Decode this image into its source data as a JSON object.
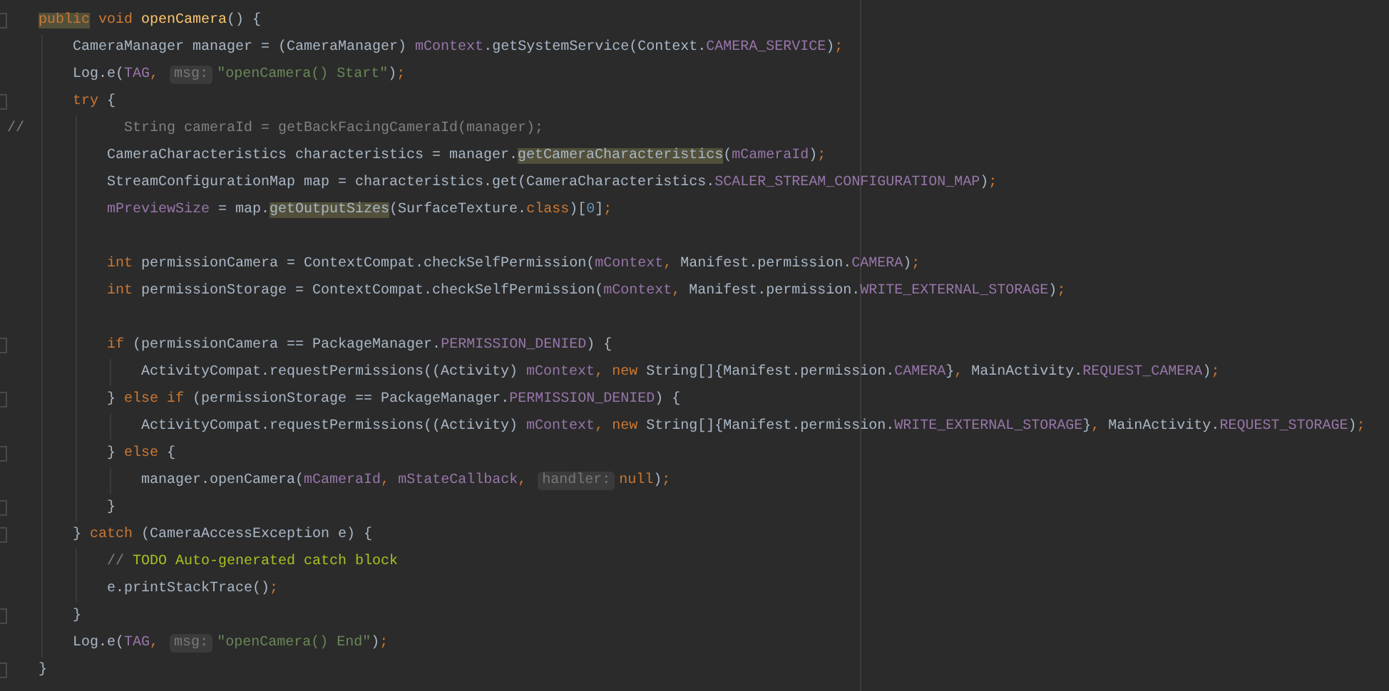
{
  "editor": {
    "lines": [
      {
        "kind": "code",
        "fold_marker": true,
        "tokens": [
          {
            "kind": "keyword_highlight",
            "text": "public"
          },
          {
            "kind": "keyword",
            "text": " void"
          },
          {
            "kind": "method",
            "text": " openCamera"
          },
          {
            "kind": "plain",
            "text": "() {"
          }
        ],
        "children": [
          {
            "kind": "code",
            "fold_marker": false,
            "tokens": [
              {
                "kind": "plain",
                "text": "CameraManager manager = (CameraManager) "
              },
              {
                "kind": "field",
                "text": "mContext"
              },
              {
                "kind": "plain",
                "text": ".getSystemService(Context."
              },
              {
                "kind": "field",
                "text": "CAMERA_SERVICE"
              },
              {
                "kind": "plain",
                "text": ")"
              },
              {
                "kind": "keyword",
                "text": ";"
              }
            ]
          },
          {
            "kind": "code",
            "fold_marker": false,
            "tokens": [
              {
                "kind": "plain",
                "text": "Log.e("
              },
              {
                "kind": "field",
                "text": "TAG"
              },
              {
                "kind": "keyword",
                "text": ", "
              },
              {
                "kind": "hint",
                "text": "msg:"
              },
              {
                "kind": "string",
                "text": "\"openCamera() Start\""
              },
              {
                "kind": "plain",
                "text": ")"
              },
              {
                "kind": "keyword",
                "text": ";"
              }
            ]
          },
          {
            "kind": "code",
            "fold_marker": true,
            "tokens": [
              {
                "kind": "keyword",
                "text": "try"
              },
              {
                "kind": "plain",
                "text": " {"
              }
            ],
            "children": [
              {
                "kind": "commented",
                "fold_marker": false,
                "prefix": "//",
                "tokens": [
                  {
                    "kind": "comment",
                    "text": "String cameraId = getBackFacingCameraId(manager);"
                  }
                ]
              },
              {
                "kind": "code",
                "fold_marker": false,
                "tokens": [
                  {
                    "kind": "plain",
                    "text": "CameraCharacteristics characteristics = manager."
                  },
                  {
                    "kind": "highlight",
                    "text": "getCameraCharacteristics"
                  },
                  {
                    "kind": "plain",
                    "text": "("
                  },
                  {
                    "kind": "field",
                    "text": "mCameraId"
                  },
                  {
                    "kind": "plain",
                    "text": ")"
                  },
                  {
                    "kind": "keyword",
                    "text": ";"
                  }
                ]
              },
              {
                "kind": "code",
                "fold_marker": false,
                "tokens": [
                  {
                    "kind": "plain",
                    "text": "StreamConfigurationMap map = characteristics.get(CameraCharacteristics."
                  },
                  {
                    "kind": "field",
                    "text": "SCALER_STREAM_CONFIGURATION_MAP"
                  },
                  {
                    "kind": "plain",
                    "text": ")"
                  },
                  {
                    "kind": "keyword",
                    "text": ";"
                  }
                ]
              },
              {
                "kind": "code",
                "fold_marker": false,
                "tokens": [
                  {
                    "kind": "field",
                    "text": "mPreviewSize"
                  },
                  {
                    "kind": "plain",
                    "text": " = map."
                  },
                  {
                    "kind": "highlight",
                    "text": "getOutputSizes"
                  },
                  {
                    "kind": "plain",
                    "text": "(SurfaceTexture."
                  },
                  {
                    "kind": "keyword",
                    "text": "class"
                  },
                  {
                    "kind": "plain",
                    "text": ")["
                  },
                  {
                    "kind": "number",
                    "text": "0"
                  },
                  {
                    "kind": "plain",
                    "text": "]"
                  },
                  {
                    "kind": "keyword",
                    "text": ";"
                  }
                ]
              },
              {
                "kind": "blank",
                "fold_marker": false
              },
              {
                "kind": "code",
                "fold_marker": false,
                "tokens": [
                  {
                    "kind": "keyword",
                    "text": "int"
                  },
                  {
                    "kind": "plain",
                    "text": " permissionCamera = ContextCompat.checkSelfPermission("
                  },
                  {
                    "kind": "field",
                    "text": "mContext"
                  },
                  {
                    "kind": "keyword",
                    "text": ","
                  },
                  {
                    "kind": "plain",
                    "text": " Manifest.permission."
                  },
                  {
                    "kind": "field",
                    "text": "CAMERA"
                  },
                  {
                    "kind": "plain",
                    "text": ")"
                  },
                  {
                    "kind": "keyword",
                    "text": ";"
                  }
                ]
              },
              {
                "kind": "code",
                "fold_marker": false,
                "tokens": [
                  {
                    "kind": "keyword",
                    "text": "int"
                  },
                  {
                    "kind": "plain",
                    "text": " permissionStorage = ContextCompat.checkSelfPermission("
                  },
                  {
                    "kind": "field",
                    "text": "mContext"
                  },
                  {
                    "kind": "keyword",
                    "text": ","
                  },
                  {
                    "kind": "plain",
                    "text": " Manifest.permission."
                  },
                  {
                    "kind": "field",
                    "text": "WRITE_EXTERNAL_STORAGE"
                  },
                  {
                    "kind": "plain",
                    "text": ")"
                  },
                  {
                    "kind": "keyword",
                    "text": ";"
                  }
                ]
              },
              {
                "kind": "blank",
                "fold_marker": false
              },
              {
                "kind": "code",
                "fold_marker": true,
                "tokens": [
                  {
                    "kind": "keyword",
                    "text": "if"
                  },
                  {
                    "kind": "plain",
                    "text": " (permissionCamera == PackageManager."
                  },
                  {
                    "kind": "field",
                    "text": "PERMISSION_DENIED"
                  },
                  {
                    "kind": "plain",
                    "text": ") {"
                  }
                ],
                "children": [
                  {
                    "kind": "code",
                    "fold_marker": false,
                    "tokens": [
                      {
                        "kind": "plain",
                        "text": "ActivityCompat.requestPermissions((Activity) "
                      },
                      {
                        "kind": "field",
                        "text": "mContext"
                      },
                      {
                        "kind": "keyword",
                        "text": ", new"
                      },
                      {
                        "kind": "plain",
                        "text": " String[]{Manifest.permission."
                      },
                      {
                        "kind": "field",
                        "text": "CAMERA"
                      },
                      {
                        "kind": "plain",
                        "text": "}"
                      },
                      {
                        "kind": "keyword",
                        "text": ","
                      },
                      {
                        "kind": "plain",
                        "text": " MainActivity."
                      },
                      {
                        "kind": "field",
                        "text": "REQUEST_CAMERA"
                      },
                      {
                        "kind": "plain",
                        "text": ")"
                      },
                      {
                        "kind": "keyword",
                        "text": ";"
                      }
                    ]
                  }
                ]
              },
              {
                "kind": "code",
                "fold_marker": true,
                "tokens": [
                  {
                    "kind": "plain",
                    "text": "} "
                  },
                  {
                    "kind": "keyword",
                    "text": "else if"
                  },
                  {
                    "kind": "plain",
                    "text": " (permissionStorage == PackageManager."
                  },
                  {
                    "kind": "field",
                    "text": "PERMISSION_DENIED"
                  },
                  {
                    "kind": "plain",
                    "text": ") {"
                  }
                ],
                "children": [
                  {
                    "kind": "code",
                    "fold_marker": false,
                    "tokens": [
                      {
                        "kind": "plain",
                        "text": "ActivityCompat.requestPermissions((Activity) "
                      },
                      {
                        "kind": "field",
                        "text": "mContext"
                      },
                      {
                        "kind": "keyword",
                        "text": ", new"
                      },
                      {
                        "kind": "plain",
                        "text": " String[]{Manifest.permission."
                      },
                      {
                        "kind": "field",
                        "text": "WRITE_EXTERNAL_STORAGE"
                      },
                      {
                        "kind": "plain",
                        "text": "}"
                      },
                      {
                        "kind": "keyword",
                        "text": ","
                      },
                      {
                        "kind": "plain",
                        "text": " MainActivity."
                      },
                      {
                        "kind": "field",
                        "text": "REQUEST_STORAGE"
                      },
                      {
                        "kind": "plain",
                        "text": ")"
                      },
                      {
                        "kind": "keyword",
                        "text": ";"
                      }
                    ]
                  }
                ]
              },
              {
                "kind": "code",
                "fold_marker": true,
                "tokens": [
                  {
                    "kind": "plain",
                    "text": "} "
                  },
                  {
                    "kind": "keyword",
                    "text": "else"
                  },
                  {
                    "kind": "plain",
                    "text": " {"
                  }
                ],
                "children": [
                  {
                    "kind": "code",
                    "fold_marker": false,
                    "tokens": [
                      {
                        "kind": "plain",
                        "text": "manager.openCamera("
                      },
                      {
                        "kind": "field",
                        "text": "mCameraId"
                      },
                      {
                        "kind": "keyword",
                        "text": ","
                      },
                      {
                        "kind": "field",
                        "text": " mStateCallback"
                      },
                      {
                        "kind": "keyword",
                        "text": ", "
                      },
                      {
                        "kind": "hint",
                        "text": "handler:"
                      },
                      {
                        "kind": "keyword",
                        "text": "null"
                      },
                      {
                        "kind": "plain",
                        "text": ")"
                      },
                      {
                        "kind": "keyword",
                        "text": ";"
                      }
                    ]
                  }
                ]
              },
              {
                "kind": "code",
                "fold_marker": true,
                "tokens": [
                  {
                    "kind": "plain",
                    "text": "}"
                  }
                ]
              }
            ]
          },
          {
            "kind": "code",
            "fold_marker": true,
            "tokens": [
              {
                "kind": "plain",
                "text": "} "
              },
              {
                "kind": "keyword",
                "text": "catch"
              },
              {
                "kind": "plain",
                "text": " (CameraAccessException e) {"
              }
            ],
            "children": [
              {
                "kind": "code",
                "fold_marker": false,
                "tokens": [
                  {
                    "kind": "comment",
                    "text": "// "
                  },
                  {
                    "kind": "todo",
                    "text": "TODO Auto-generated catch block"
                  }
                ]
              },
              {
                "kind": "code",
                "fold_marker": false,
                "tokens": [
                  {
                    "kind": "plain",
                    "text": "e.printStackTrace()"
                  },
                  {
                    "kind": "keyword",
                    "text": ";"
                  }
                ]
              }
            ]
          },
          {
            "kind": "code",
            "fold_marker": true,
            "tokens": [
              {
                "kind": "plain",
                "text": "}"
              }
            ]
          },
          {
            "kind": "code",
            "fold_marker": false,
            "tokens": [
              {
                "kind": "plain",
                "text": "Log.e("
              },
              {
                "kind": "field",
                "text": "TAG"
              },
              {
                "kind": "keyword",
                "text": ", "
              },
              {
                "kind": "hint",
                "text": "msg:"
              },
              {
                "kind": "string",
                "text": "\"openCamera() End\""
              },
              {
                "kind": "plain",
                "text": ")"
              },
              {
                "kind": "keyword",
                "text": ";"
              }
            ]
          }
        ]
      },
      {
        "kind": "code",
        "fold_marker": true,
        "tokens": [
          {
            "kind": "plain",
            "text": "}"
          }
        ]
      }
    ]
  }
}
